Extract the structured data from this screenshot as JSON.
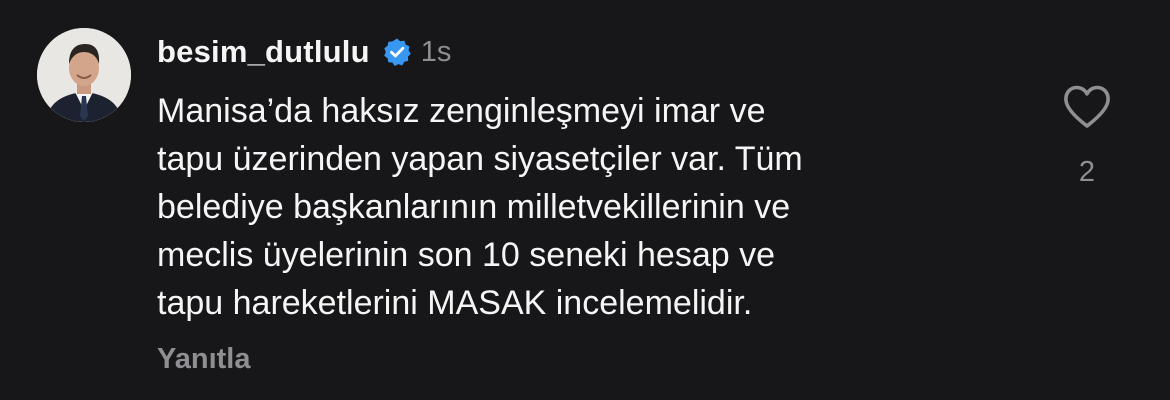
{
  "comment": {
    "avatar_icon": "profile-avatar",
    "username": "besim_dutlulu",
    "verified_icon": "verified-badge-icon",
    "verified_color": "#3897f0",
    "timestamp": "1s",
    "text": "Manisa’da haksız zenginleşmeyi imar ve\ntapu üzerinden yapan siyasetçiler var. Tüm\nbelediye başkanlarının milletvekillerinin ve\nmeclis üyelerinin son 10 seneki hesap ve\ntapu hareketlerini MASAK incelemelidir.",
    "reply_label": "Yanıtla",
    "like_icon": "heart-outline-icon",
    "like_count": "2"
  },
  "colors": {
    "background": "#17171a",
    "primary_text": "#f5f5f5",
    "secondary_text": "#8e8e93"
  }
}
